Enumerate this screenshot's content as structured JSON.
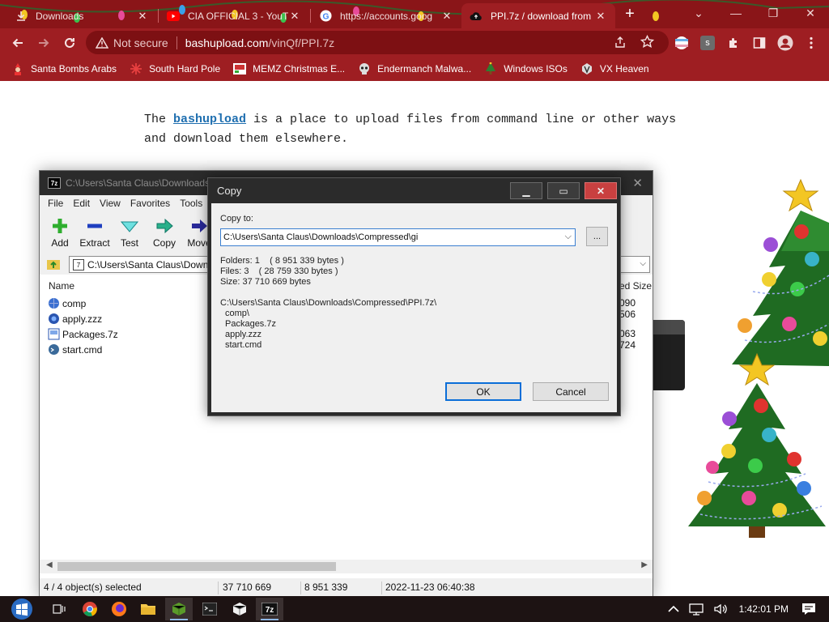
{
  "browser": {
    "tabs": [
      {
        "title": "Downloads",
        "favicon": "download-icon",
        "active": false
      },
      {
        "title": "CIA OFFICIAL 3 - YouT",
        "favicon": "youtube-icon",
        "active": false
      },
      {
        "title": "https://accounts.goog",
        "favicon": "google-icon",
        "active": false
      },
      {
        "title": "PPI.7z / download from",
        "favicon": "cloud-upload-icon",
        "active": true
      }
    ],
    "new_tab_label": "+",
    "security_label": "Not secure",
    "url_host": "bashupload.com",
    "url_path": "/vinQf/PPI.7z",
    "profile_badge": "s",
    "bookmarks": [
      {
        "label": "Santa Bombs Arabs",
        "icon": "santa-icon"
      },
      {
        "label": "South Hard Pole",
        "icon": "snowflake-icon"
      },
      {
        "label": "MEMZ Christmas E...",
        "icon": "memz-icon"
      },
      {
        "label": "Endermanch Malwa...",
        "icon": "skull-icon"
      },
      {
        "label": "Windows ISOs",
        "icon": "tree-icon"
      },
      {
        "label": "VX Heaven",
        "icon": "vx-icon"
      }
    ]
  },
  "page": {
    "intro_before": "The ",
    "intro_link": "bashupload",
    "intro_after": " is a place to upload files from command line or other ways and download them elsewhere."
  },
  "zip": {
    "title": "C:\\Users\\Santa Claus\\Downloads",
    "app_badge": "7z",
    "menu": [
      "File",
      "Edit",
      "View",
      "Favorites",
      "Tools"
    ],
    "tools": [
      {
        "label": "Add",
        "icon": "plus-icon"
      },
      {
        "label": "Extract",
        "icon": "minus-icon"
      },
      {
        "label": "Test",
        "icon": "check-icon"
      },
      {
        "label": "Copy",
        "icon": "copy-arrow-icon"
      },
      {
        "label": "Move",
        "icon": "move-arrow-icon"
      }
    ],
    "address": "C:\\Users\\Santa Claus\\Downl",
    "col_name": "Name",
    "col_right": "ed Size",
    "files": [
      {
        "name": "comp",
        "icon": "folder-globe-icon",
        "value": "090 506"
      },
      {
        "name": "apply.zzz",
        "icon": "file-globe-icon",
        "value": ""
      },
      {
        "name": "Packages.7z",
        "icon": "archive-icon",
        "value": "063 724"
      },
      {
        "name": "start.cmd",
        "icon": "cmd-file-icon",
        "value": ""
      }
    ],
    "status": {
      "selected": "4 / 4 object(s) selected",
      "size": "37 710 669",
      "packed": "8 951 339",
      "date": "2022-11-23 06:40:38"
    }
  },
  "copy_dialog": {
    "title": "Copy",
    "copy_to_label": "Copy to:",
    "path_value": "C:\\Users\\Santa Claus\\Downloads\\Compressed\\gi",
    "browse_label": "...",
    "folders": "Folders: 1    ( 8 951 339 bytes )",
    "files_count": "Files: 3    ( 28 759 330 bytes )",
    "size": "Size: 37 710 669 bytes",
    "archive_path": "C:\\Users\\Santa Claus\\Downloads\\Compressed\\PPI.7z\\",
    "items": [
      "comp\\",
      "Packages.7z",
      "apply.zzz",
      "start.cmd"
    ],
    "ok_label": "OK",
    "cancel_label": "Cancel"
  },
  "taskbar": {
    "clock": "1:42:01 PM",
    "apps": [
      "task-view-icon",
      "chrome-icon",
      "firefox-icon",
      "explorer-icon",
      "minecraft-icon",
      "cmd-icon",
      "package-icon",
      "7zip-icon"
    ]
  },
  "colors": {
    "chrome_frame": "#8a1518",
    "chrome_toolbar": "#9e1e22",
    "link": "#1f6fb0",
    "dialog_title": "#2b2b2b",
    "ok_border": "#0a6ed8"
  }
}
